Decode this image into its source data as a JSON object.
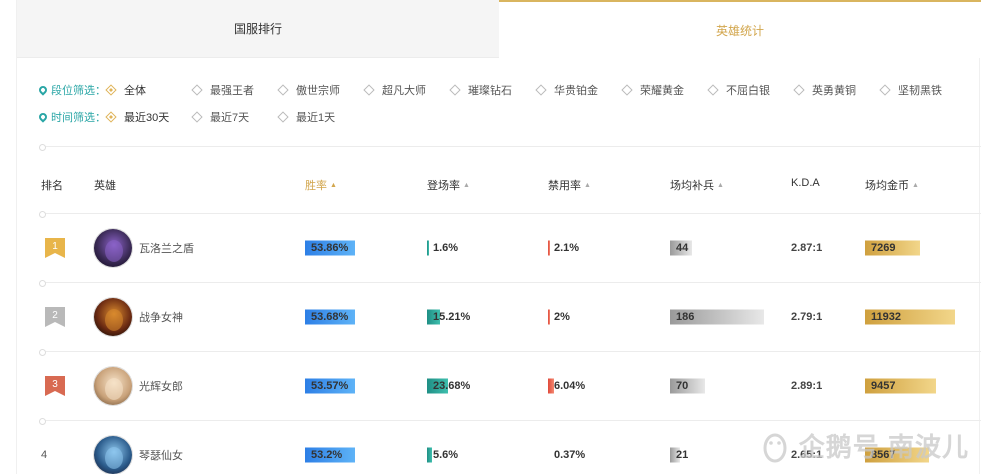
{
  "tabs": [
    "国服排行",
    "英雄统计"
  ],
  "filters": {
    "rank_label": "段位筛选：",
    "rank_options": [
      "全体",
      "最强王者",
      "傲世宗师",
      "超凡大师",
      "璀璨钻石",
      "华贵铂金",
      "荣耀黄金",
      "不屈白银",
      "英勇黄铜",
      "坚韧黑铁"
    ],
    "rank_selected": 0,
    "time_label": "时间筛选：",
    "time_options": [
      "最近30天",
      "最近7天",
      "最近1天"
    ],
    "time_selected": 0
  },
  "table": {
    "headers": [
      "排名",
      "英雄",
      "胜率",
      "登场率",
      "禁用率",
      "场均补兵",
      "K.D.A",
      "场均金币"
    ],
    "rows": [
      {
        "rank": "1",
        "hero": "瓦洛兰之盾",
        "win": "53.86%",
        "pick": "1.6%",
        "pick_frac": 0.01,
        "ban": "2.1%",
        "ban_frac": 0.01,
        "cs": "44",
        "cs_frac": 0.23,
        "kda": "2.87:1",
        "gold": "7269",
        "gold_frac": 0.61
      },
      {
        "rank": "2",
        "hero": "战争女神",
        "win": "53.68%",
        "pick": "15.21%",
        "pick_frac": 0.19,
        "ban": "2%",
        "ban_frac": 0.01,
        "cs": "186",
        "cs_frac": 1.0,
        "kda": "2.79:1",
        "gold": "11932",
        "gold_frac": 1.0
      },
      {
        "rank": "3",
        "hero": "光辉女郎",
        "win": "53.57%",
        "pick": "23.68%",
        "pick_frac": 0.3,
        "ban": "6.04%",
        "ban_frac": 0.08,
        "cs": "70",
        "cs_frac": 0.37,
        "kda": "2.89:1",
        "gold": "9457",
        "gold_frac": 0.79
      },
      {
        "rank": "4",
        "hero": "琴瑟仙女",
        "win": "53.2%",
        "pick": "5.6%",
        "pick_frac": 0.07,
        "ban": "0.37%",
        "ban_frac": 0.0,
        "cs": "21",
        "cs_frac": 0.11,
        "kda": "2.65:1",
        "gold": "8567",
        "gold_frac": 0.71
      }
    ]
  },
  "watermark": "企鹅号 南波儿",
  "colors": {
    "accent": "#d2a64d",
    "teal": "#2aa6a6",
    "win_bar": "#3d95f0",
    "pick_bar": "#2aa79b",
    "ban_bar": "#e8614f",
    "cs_bar": "#b5b5b5",
    "gold_bar": "#ddb354"
  }
}
